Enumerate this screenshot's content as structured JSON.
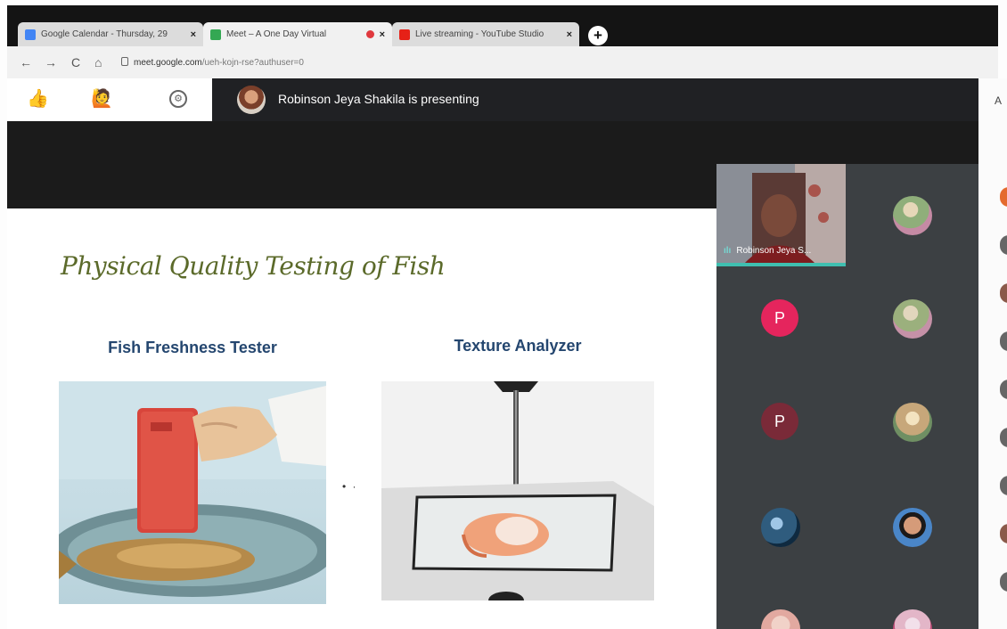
{
  "browser": {
    "tabs": [
      {
        "title": "Google Calendar - Thursday, 29",
        "favicon_color": "#4285f4",
        "active": false,
        "close": "×"
      },
      {
        "title": "Meet – A One Day Virtual",
        "favicon_color": "#34a853",
        "active": true,
        "recording": true,
        "close": "×"
      },
      {
        "title": "Live streaming - YouTube Studio",
        "favicon_color": "#e62117",
        "active": false,
        "close": "×"
      }
    ],
    "new_tab": "+",
    "url_host": "meet.google.com",
    "url_path": "/ueh-kojn-rse?authuser=0",
    "nav": {
      "back": "←",
      "forward": "→",
      "reload": "C",
      "home": "⌂"
    }
  },
  "meet": {
    "reactions": {
      "thumbs_up": "👍",
      "raise_hand": "🙋",
      "settings_icon": "⚙"
    },
    "presenting_text": "Robinson Jeya Shakila is presenting",
    "participants": [
      {
        "kind": "video",
        "name": "Robinson Jeya S..."
      },
      {
        "kind": "avatar",
        "tone": "#8fae7a"
      },
      {
        "kind": "letter",
        "letter": "P",
        "color": "#e5255d"
      },
      {
        "kind": "avatar",
        "tone": "#9bb07d"
      },
      {
        "kind": "letter",
        "letter": "P",
        "color": "#7a2a38"
      },
      {
        "kind": "avatar",
        "tone": "#c7a77a"
      },
      {
        "kind": "avatar",
        "tone": "#2f5c7e"
      },
      {
        "kind": "avatar",
        "tone": "#4a86c8"
      },
      {
        "kind": "avatar",
        "tone": "#e2a9a0"
      },
      {
        "kind": "avatar",
        "tone": "#e3b6c8"
      }
    ],
    "side_letter": "A"
  },
  "slide": {
    "title": "Physical Quality Testing of Fish",
    "left_caption": "Fish Freshness Tester",
    "right_caption": "Texture Analyzer",
    "separator": "• ·"
  }
}
